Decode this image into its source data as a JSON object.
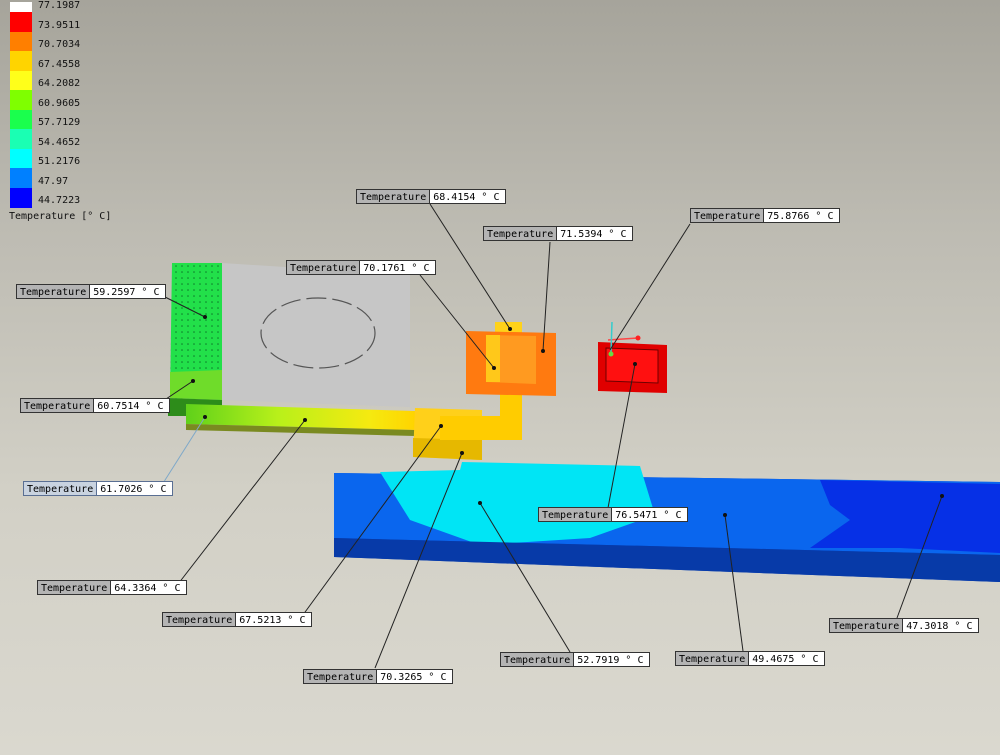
{
  "legend": {
    "title": "Temperature [° C]",
    "scale": [
      {
        "value": "77.1987",
        "color": "#ffffff"
      },
      {
        "value": "73.9511",
        "color": "#ff0000"
      },
      {
        "value": "70.7034",
        "color": "#ff7f00"
      },
      {
        "value": "67.4558",
        "color": "#ffd400"
      },
      {
        "value": "64.2082",
        "color": "#ffff1a"
      },
      {
        "value": "60.9605",
        "color": "#7fff00"
      },
      {
        "value": "57.7129",
        "color": "#1aff4d"
      },
      {
        "value": "54.4652",
        "color": "#1affb3"
      },
      {
        "value": "51.2176",
        "color": "#00ffff"
      },
      {
        "value": "47.97",
        "color": "#0080ff"
      },
      {
        "value": "44.7223",
        "color": "#0000ff"
      }
    ]
  },
  "probes": [
    {
      "name": "probe-68-4154",
      "label": "Temperature",
      "value": "68.4154 ° C"
    },
    {
      "name": "probe-71-5394",
      "label": "Temperature",
      "value": "71.5394 ° C"
    },
    {
      "name": "probe-75-8766",
      "label": "Temperature",
      "value": "75.8766 ° C"
    },
    {
      "name": "probe-70-1761",
      "label": "Temperature",
      "value": "70.1761 ° C"
    },
    {
      "name": "probe-59-2597",
      "label": "Temperature",
      "value": "59.2597 ° C"
    },
    {
      "name": "probe-60-7514",
      "label": "Temperature",
      "value": "60.7514 ° C"
    },
    {
      "name": "probe-61-7026",
      "label": "Temperature",
      "value": "61.7026 ° C"
    },
    {
      "name": "probe-76-5471",
      "label": "Temperature",
      "value": "76.5471 ° C"
    },
    {
      "name": "probe-64-3364",
      "label": "Temperature",
      "value": "64.3364 ° C"
    },
    {
      "name": "probe-67-5213",
      "label": "Temperature",
      "value": "67.5213 ° C"
    },
    {
      "name": "probe-70-3265",
      "label": "Temperature",
      "value": "70.3265 ° C"
    },
    {
      "name": "probe-52-7919",
      "label": "Temperature",
      "value": "52.7919 ° C"
    },
    {
      "name": "probe-49-4675",
      "label": "Temperature",
      "value": "49.4675 ° C"
    },
    {
      "name": "probe-47-3018",
      "label": "Temperature",
      "value": "47.3018 ° C"
    }
  ]
}
